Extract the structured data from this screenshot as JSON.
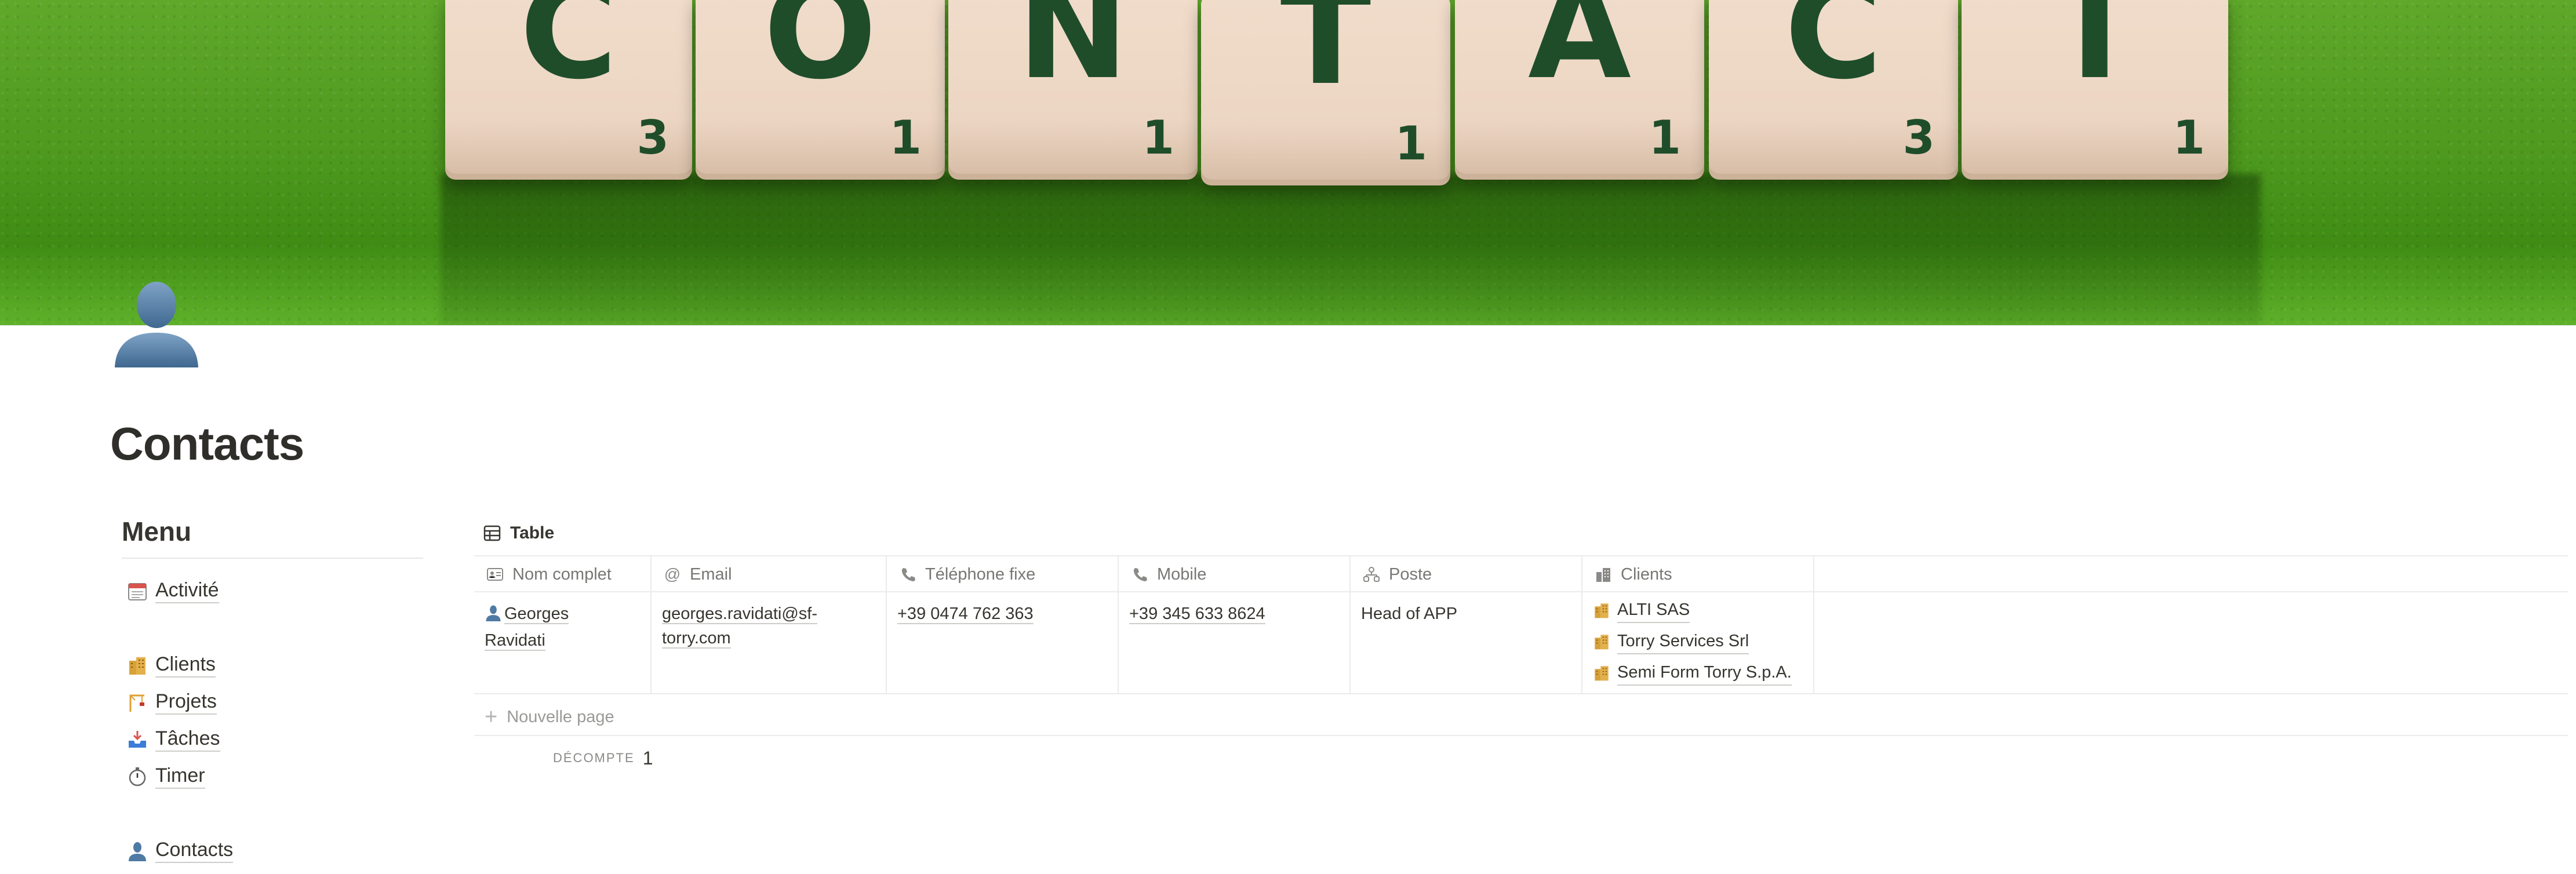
{
  "cover": {
    "tiles": [
      {
        "letter": "C",
        "score": "3"
      },
      {
        "letter": "O",
        "score": "1"
      },
      {
        "letter": "N",
        "score": "1"
      },
      {
        "letter": "T",
        "score": "1"
      },
      {
        "letter": "A",
        "score": "1"
      },
      {
        "letter": "C",
        "score": "3"
      },
      {
        "letter": "T",
        "score": "1"
      }
    ]
  },
  "page": {
    "title": "Contacts",
    "icon": "person-silhouette-icon"
  },
  "menu": {
    "title": "Menu",
    "items": [
      {
        "label": "Activité",
        "icon": "calendar-icon"
      },
      {
        "label": "Clients",
        "icon": "office-building-icon"
      },
      {
        "label": "Projets",
        "icon": "construction-crane-icon"
      },
      {
        "label": "Tâches",
        "icon": "inbox-tray-icon"
      },
      {
        "label": "Timer",
        "icon": "stopwatch-icon"
      },
      {
        "label": "Contacts",
        "icon": "person-silhouette-icon"
      }
    ]
  },
  "view": {
    "tab_label": "Table",
    "tab_icon": "table-icon"
  },
  "table": {
    "columns": [
      {
        "label": "Nom complet",
        "icon": "id-card-icon"
      },
      {
        "label": "Email",
        "icon": "at-sign-icon"
      },
      {
        "label": "Téléphone fixe",
        "icon": "phone-icon"
      },
      {
        "label": "Mobile",
        "icon": "phone-icon"
      },
      {
        "label": "Poste",
        "icon": "org-chart-icon"
      },
      {
        "label": "Clients",
        "icon": "building-icon"
      }
    ],
    "rows": [
      {
        "nom_line1": "Georges",
        "nom_line2": "Ravidati",
        "email_line1": "georges.ravidati@sf-",
        "email_line2": "torry.com",
        "telephone": "+39 0474 762 363",
        "mobile": "+39 345 633 8624",
        "poste": "Head of APP",
        "clients": [
          "ALTI SAS",
          "Torry Services Srl",
          "Semi Form Torry S.p.A."
        ]
      }
    ],
    "new_page_label": "Nouvelle page",
    "count_label": "DÉCOMPTE",
    "count_value": "1"
  },
  "colors": {
    "text": "#37352f",
    "muted": "#787774",
    "border": "#ebebea",
    "banner_green": "#4f9a1f",
    "tile": "#ecd6c3",
    "tile_letter": "#1f4d2a"
  }
}
